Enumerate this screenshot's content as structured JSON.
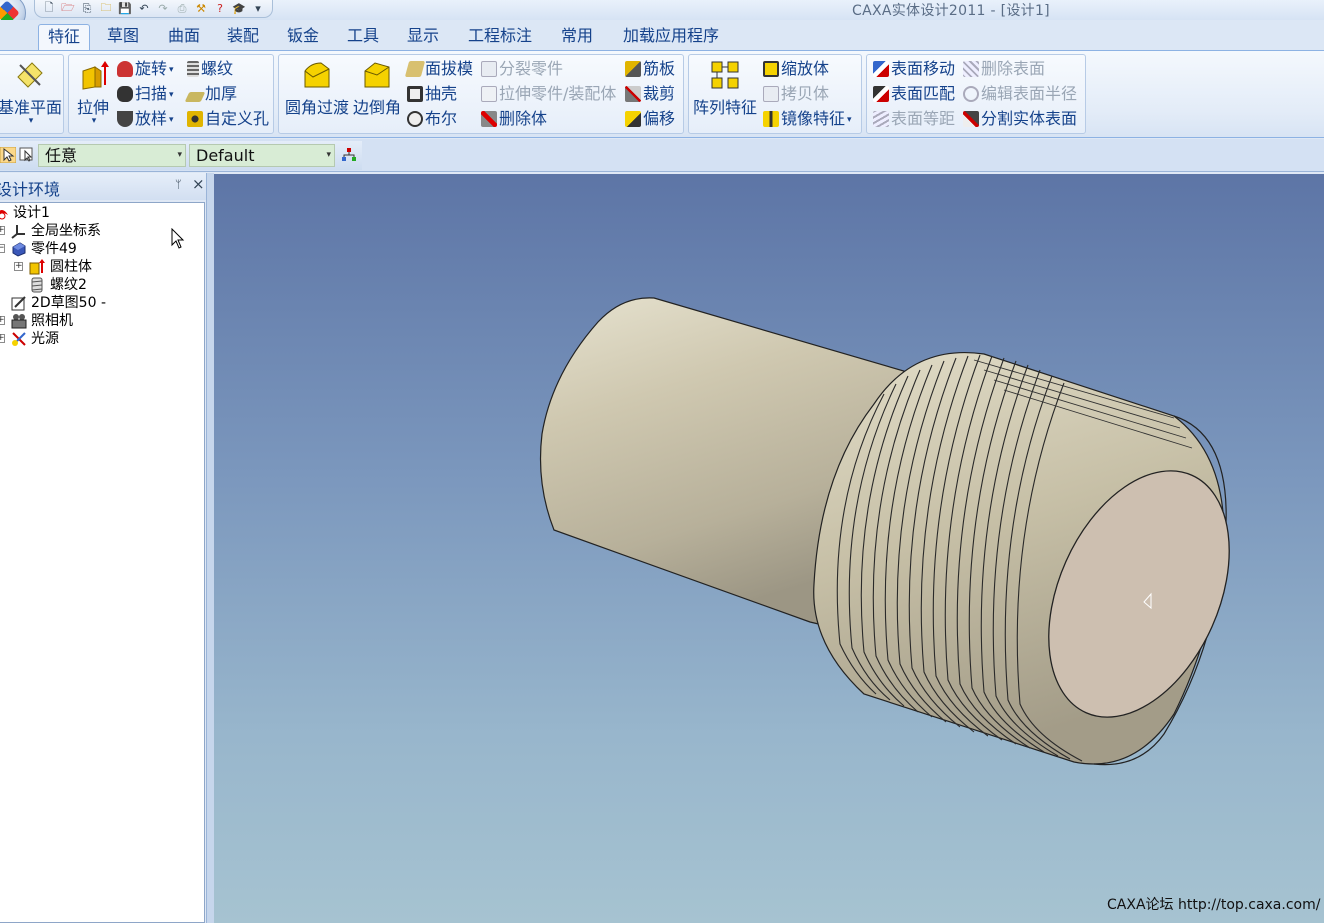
{
  "window": {
    "title": "CAXA实体设计2011 - [设计1]"
  },
  "quick_access": {
    "buttons": [
      "new-icon",
      "open-recent-icon",
      "import-icon",
      "open-icon",
      "save-icon",
      "undo-icon",
      "redo-icon",
      "print-icon",
      "tool-icon",
      "help-icon",
      "learn-icon"
    ],
    "more": "▾"
  },
  "ribbon": {
    "tabs": [
      "特征",
      "草图",
      "曲面",
      "装配",
      "钣金",
      "工具",
      "显示",
      "工程标注",
      "常用",
      "加载应用程序"
    ],
    "active_tab": "特征",
    "groups": {
      "datum": {
        "plane": "基准平面"
      },
      "features": {
        "extrude": "拉伸",
        "revolve": "旋转",
        "sweep": "扫描",
        "loft": "放样",
        "thread": "螺纹",
        "thicken": "加厚",
        "custom_hole": "自定义孔"
      },
      "modify": {
        "fillet": "圆角过渡",
        "chamfer": "边倒角",
        "draft": "面拔模",
        "shell": "抽壳",
        "boolean": "布尔",
        "split_part": "分裂零件",
        "extrude_part": "拉伸零件/装配体",
        "delete_body": "删除体",
        "rib": "筋板",
        "trim": "裁剪",
        "offset": "偏移"
      },
      "transform": {
        "pattern": "阵列特征",
        "scale": "缩放体",
        "copy": "拷贝体",
        "mirror": "镜像特征"
      },
      "direct_edit": {
        "move_face": "表面移动",
        "match_face": "表面匹配",
        "offset_face": "表面等距",
        "delete_face": "删除表面",
        "edit_radius": "编辑表面半径",
        "split_body_face": "分割实体表面"
      }
    }
  },
  "selection_bar": {
    "filter": "任意",
    "configuration": "Default"
  },
  "design_panel": {
    "title": "设计环境",
    "tree": [
      {
        "label": "设计1",
        "icon": "design-icon"
      },
      {
        "label": "全局坐标系",
        "icon": "axis-icon"
      },
      {
        "label": "零件49",
        "icon": "part-icon"
      },
      {
        "label": "圆柱体",
        "icon": "cylinder-icon"
      },
      {
        "label": "螺纹2",
        "icon": "thread-icon"
      },
      {
        "label": "2D草图50 -",
        "icon": "sketch-icon"
      },
      {
        "label": "照相机",
        "icon": "camera-icon"
      },
      {
        "label": "光源",
        "icon": "light-icon"
      }
    ]
  },
  "viewport": {
    "watermark": "CAXA论坛 http://top.caxa.com/"
  },
  "colors": {
    "ribbon_text": "#15428b",
    "viewport_top": "#5d75a6",
    "viewport_bottom": "#a6c3d1",
    "part_body": "#cfc8b0",
    "part_end_face": "#cdbfb0"
  }
}
